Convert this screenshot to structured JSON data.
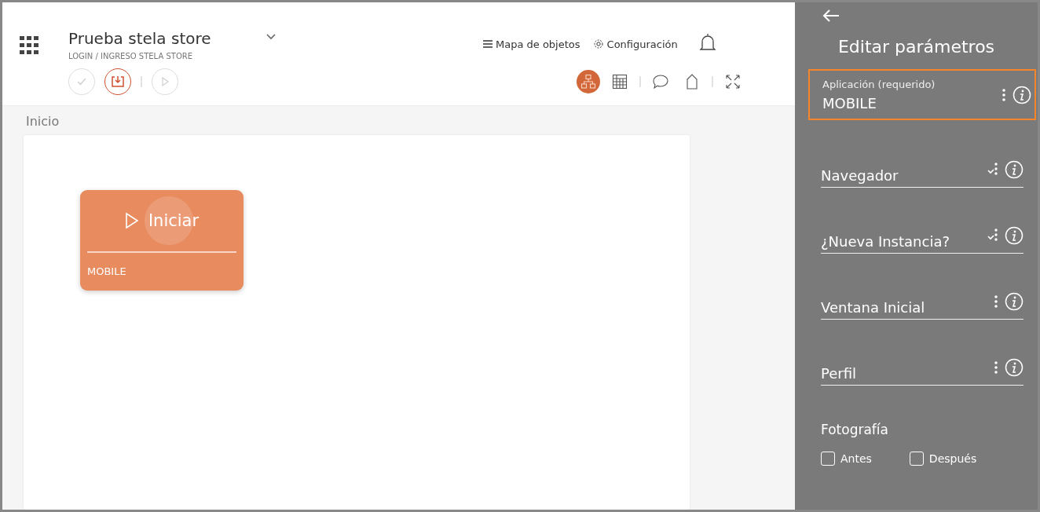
{
  "header": {
    "title": "Prueba stela store",
    "subtitle": "LOGIN / INGRESO STELA STORE",
    "links": [
      {
        "kind": "menu",
        "label": "Mapa de objetos"
      },
      {
        "kind": "gear",
        "label": "Configuración"
      }
    ]
  },
  "actions": [
    {
      "kind": "check",
      "enabled": false
    },
    {
      "kind": "download",
      "enabled": true
    },
    {
      "kind": "play",
      "enabled": false
    }
  ],
  "views": [
    {
      "kind": "flow",
      "selected": true
    },
    {
      "kind": "grid",
      "selected": false
    },
    {
      "kind": "comment",
      "selected": false
    },
    {
      "kind": "tag",
      "selected": false
    },
    {
      "kind": "expand",
      "selected": false
    }
  ],
  "breadcrumb": "Inicio",
  "node": {
    "label": "Iniciar",
    "value": "MOBILE"
  },
  "panel": {
    "title": "Editar parámetros",
    "fields": [
      {
        "label": "Aplicación (requerido)",
        "value": "MOBILE",
        "selected": true,
        "kind": "dots"
      },
      {
        "label": "Navegador",
        "selected": false,
        "kind": "dots-check"
      },
      {
        "label": "¿Nueva Instancia?",
        "selected": false,
        "kind": "dots-check"
      },
      {
        "label": "Ventana Inicial",
        "selected": false,
        "kind": "dots"
      },
      {
        "label": "Perfil",
        "selected": false,
        "kind": "dots"
      }
    ],
    "photo": {
      "label": "Fotografía",
      "options": [
        {
          "label": "Antes",
          "checked": false
        },
        {
          "label": "Después",
          "checked": false
        }
      ]
    }
  }
}
